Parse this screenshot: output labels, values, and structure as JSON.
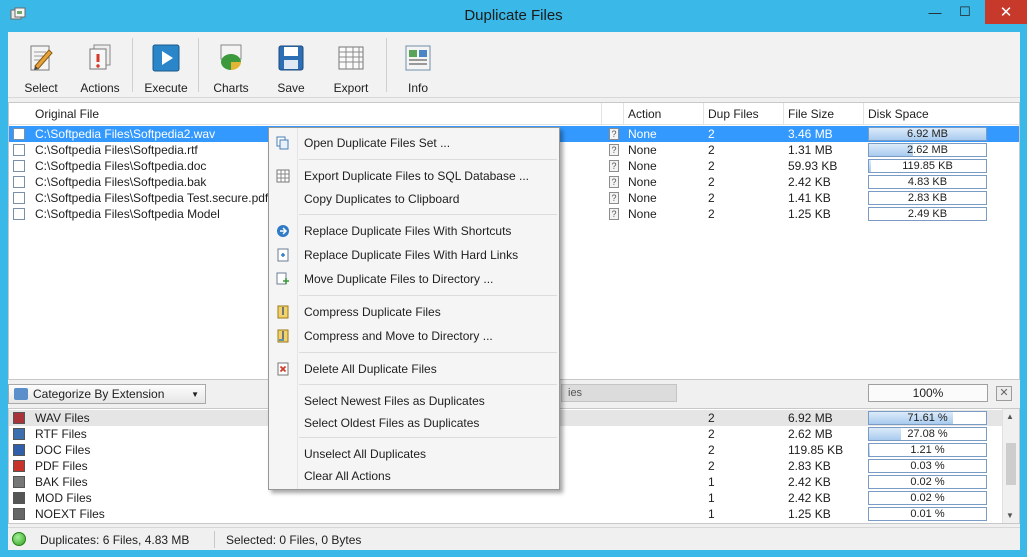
{
  "window": {
    "title": "Duplicate Files",
    "min_glyph": "—",
    "max_glyph": "☐",
    "close_glyph": "✕"
  },
  "toolbar": {
    "buttons": [
      {
        "label": "Select",
        "icon": "select-icon"
      },
      {
        "label": "Actions",
        "icon": "actions-icon"
      },
      {
        "label": "Execute",
        "icon": "execute-icon"
      },
      {
        "label": "Charts",
        "icon": "charts-icon"
      },
      {
        "label": "Save",
        "icon": "save-icon"
      },
      {
        "label": "Export",
        "icon": "export-icon"
      },
      {
        "label": "Info",
        "icon": "info-icon"
      }
    ]
  },
  "file_list": {
    "columns": [
      "Original File",
      "Action",
      "Dup Files",
      "File Size",
      "Disk Space"
    ],
    "rows": [
      {
        "file": "C:\\Softpedia Files\\Softpedia2.wav",
        "action": "None",
        "dups": "2",
        "size": "3.46 MB",
        "disk": "6.92 MB",
        "disk_fraction": 1.0,
        "selected": true
      },
      {
        "file": "C:\\Softpedia Files\\Softpedia.rtf",
        "action": "None",
        "dups": "2",
        "size": "1.31 MB",
        "disk": "2.62 MB",
        "disk_fraction": 0.38
      },
      {
        "file": "C:\\Softpedia Files\\Softpedia.doc",
        "action": "None",
        "dups": "2",
        "size": "59.93 KB",
        "disk": "119.85 KB",
        "disk_fraction": 0.02
      },
      {
        "file": "C:\\Softpedia Files\\Softpedia.bak",
        "action": "None",
        "dups": "2",
        "size": "2.42 KB",
        "disk": "4.83 KB",
        "disk_fraction": 0.0
      },
      {
        "file": "C:\\Softpedia Files\\Softpedia Test.secure.pdf",
        "action": "None",
        "dups": "2",
        "size": "1.41 KB",
        "disk": "2.83 KB",
        "disk_fraction": 0.0
      },
      {
        "file": "C:\\Softpedia Files\\Softpedia Model",
        "action": "None",
        "dups": "2",
        "size": "1.25 KB",
        "disk": "2.49 KB",
        "disk_fraction": 0.0
      }
    ]
  },
  "middle": {
    "categorize": "Categorize By Extension",
    "hidden_label": "ies",
    "progress": "100%",
    "close_glyph": "✕"
  },
  "category_list": {
    "rows": [
      {
        "name": "WAV Files",
        "dups": "2",
        "size": "6.92 MB",
        "percent": "71.61 %",
        "fraction": 0.7161,
        "selected": true
      },
      {
        "name": "RTF Files",
        "dups": "2",
        "size": "2.62 MB",
        "percent": "27.08 %",
        "fraction": 0.2708
      },
      {
        "name": "DOC Files",
        "dups": "2",
        "size": "119.85 KB",
        "percent": "1.21 %",
        "fraction": 0.0121
      },
      {
        "name": "PDF Files",
        "dups": "2",
        "size": "2.83 KB",
        "percent": "0.03 %",
        "fraction": 0.0003
      },
      {
        "name": "BAK Files",
        "dups": "1",
        "size": "2.42 KB",
        "percent": "0.02 %",
        "fraction": 0.0002
      },
      {
        "name": "MOD Files",
        "dups": "1",
        "size": "2.42 KB",
        "percent": "0.02 %",
        "fraction": 0.0002
      },
      {
        "name": "NOEXT Files",
        "dups": "1",
        "size": "1.25 KB",
        "percent": "0.01 %",
        "fraction": 0.0001
      }
    ]
  },
  "status": {
    "duplicates": "Duplicates: 6 Files, 4.83 MB",
    "selected": "Selected: 0 Files, 0 Bytes"
  },
  "context_menu": {
    "items": [
      {
        "label": "Open Duplicate Files Set ...",
        "icon": "open-set-icon"
      },
      {
        "label": "Export Duplicate Files to SQL Database ...",
        "icon": "sql-grid-icon"
      },
      {
        "label": "Copy Duplicates to Clipboard",
        "icon": ""
      },
      {
        "label": "Replace Duplicate Files With Shortcuts",
        "icon": "arrow-right-icon"
      },
      {
        "label": "Replace Duplicate Files With Hard Links",
        "icon": "hard-link-icon"
      },
      {
        "label": "Move Duplicate Files to Directory ...",
        "icon": "move-icon"
      },
      {
        "label": "Compress Duplicate Files",
        "icon": "compress-icon"
      },
      {
        "label": "Compress and Move to Directory ...",
        "icon": "compress-move-icon"
      },
      {
        "label": "Delete All Duplicate Files",
        "icon": "delete-icon"
      },
      {
        "label": "Select Newest Files as Duplicates",
        "icon": ""
      },
      {
        "label": "Select Oldest Files as Duplicates",
        "icon": ""
      },
      {
        "label": "Unselect All Duplicates",
        "icon": ""
      },
      {
        "label": "Clear All Actions",
        "icon": ""
      }
    ]
  },
  "colors": {
    "frame": "#3ab9e8",
    "selection": "#3399ff",
    "close_button": "#c7392b"
  }
}
